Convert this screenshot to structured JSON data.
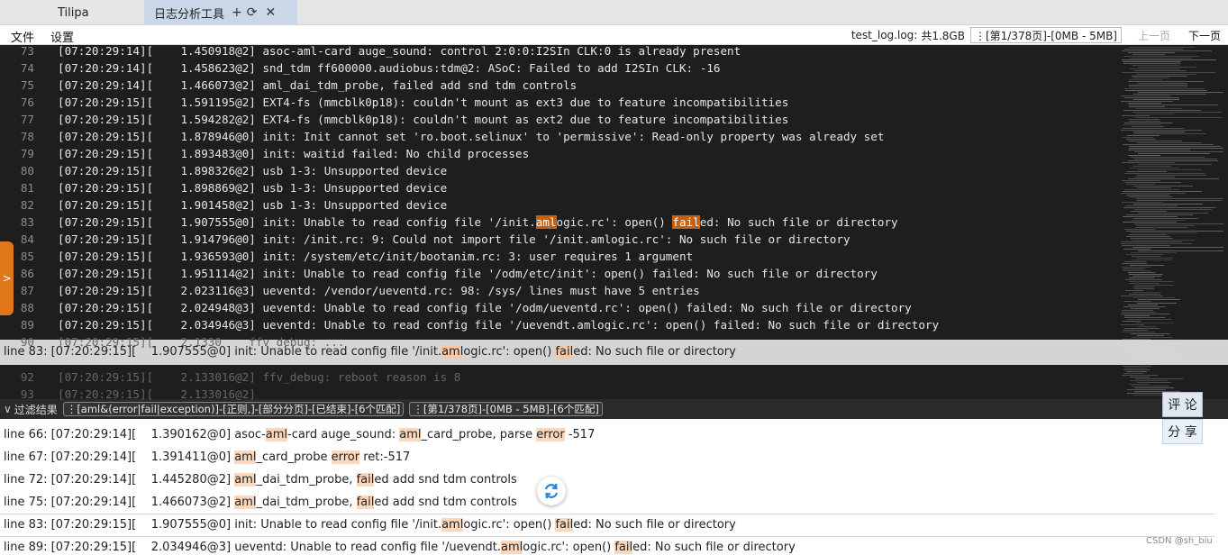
{
  "tabs": [
    {
      "label": "Tilipa"
    },
    {
      "label": "日志分析工具",
      "controls": [
        "+",
        "⟳",
        "✕"
      ]
    }
  ],
  "menu": [
    "文件",
    "设置"
  ],
  "file_info": {
    "name": "test_log.log:",
    "size": "共1.8GB",
    "page": "⋮[第1/378页]-[0MB - 5MB]",
    "prev_page": "上一页",
    "next_page": "下一页"
  },
  "side_handle": ">",
  "log_lines": [
    {
      "n": "73",
      "pre": "[07:20:29:14][    1.450918@2] asoc-aml-card auge_sound: control 2:0:0:I2SIn CLK:0 is already present",
      "h": []
    },
    {
      "n": "74",
      "pre": "[07:20:29:14][    1.458623@2] snd_tdm ff600000.audiobus:tdm@2: ASoC: Failed to add I2SIn CLK: -16",
      "h": []
    },
    {
      "n": "75",
      "pre": "[07:20:29:14][    1.466073@2] aml_dai_tdm_probe, failed add snd tdm controls",
      "h": []
    },
    {
      "n": "76",
      "pre": "[07:20:29:15][    1.591195@2] EXT4-fs (mmcblk0p18): couldn't mount as ext3 due to feature incompatibilities",
      "h": []
    },
    {
      "n": "77",
      "pre": "[07:20:29:15][    1.594282@2] EXT4-fs (mmcblk0p18): couldn't mount as ext2 due to feature incompatibilities",
      "h": []
    },
    {
      "n": "78",
      "pre": "[07:20:29:15][    1.878946@0] init: Init cannot set 'ro.boot.selinux' to 'permissive': Read-only property was already set",
      "h": []
    },
    {
      "n": "79",
      "pre": "[07:20:29:15][    1.893483@0] init: waitid failed: No child processes",
      "h": []
    },
    {
      "n": "80",
      "pre": "[07:20:29:15][    1.898326@2] usb 1-3: Unsupported device",
      "h": []
    },
    {
      "n": "81",
      "pre": "[07:20:29:15][    1.898869@2] usb 1-3: Unsupported device",
      "h": []
    },
    {
      "n": "82",
      "pre": "[07:20:29:15][    1.901458@2] usb 1-3: Unsupported device",
      "h": []
    },
    {
      "n": "83",
      "pre": "[07:20:29:15][    1.907555@0] init: Unable to read config file '/init.",
      "h": [
        [
          "aml",
          "ogic.rc': open() "
        ],
        [
          "fail",
          "ed: No such file or directory"
        ]
      ]
    },
    {
      "n": "84",
      "pre": "[07:20:29:15][    1.914796@0] init: /init.rc: 9: Could not import file '/init.amlogic.rc': No such file or directory",
      "h": []
    },
    {
      "n": "85",
      "pre": "[07:20:29:15][    1.936593@0] init: /system/etc/init/bootanim.rc: 3: user requires 1 argument",
      "h": []
    },
    {
      "n": "86",
      "pre": "[07:20:29:15][    1.951114@2] init: Unable to read config file '/odm/etc/init': open() failed: No such file or directory",
      "h": []
    },
    {
      "n": "87",
      "pre": "[07:20:29:15][    2.023116@3] ueventd: /vendor/ueventd.rc: 98: /sys/ lines must have 5 entries",
      "h": []
    },
    {
      "n": "88",
      "pre": "[07:20:29:15][    2.024948@3] ueventd: Unable to read config file '/odm/ueventd.rc': open() failed: No such file or directory",
      "h": []
    },
    {
      "n": "89",
      "pre": "[07:20:29:15][    2.034946@3] ueventd: Unable to read config file '/uevendt.amlogic.rc': open() failed: No such file or directory",
      "h": []
    }
  ],
  "ghost_lines": [
    {
      "n": "90",
      "text": "[07:20:29:15][    2.1330    ffv_debug: ..."
    },
    {
      "n": "92",
      "text": "[07:20:29:15][    2.133016@2] ffv_debug: reboot reason is 8"
    },
    {
      "n": "93",
      "text": "[07:20:29:15][    2.133016@2]"
    }
  ],
  "tooltip": {
    "prefix": "line 83: [07:20:29:15][    1.907555@0] init: Unable to read config file '/init.",
    "m1": "aml",
    "mid": "ogic.rc': open() ",
    "m2": "fail",
    "suffix": "ed: No such file or directory"
  },
  "filter": {
    "title": "过滤结果",
    "query_chip": "⋮[aml&(error|fail|exception)]-[正则,]-[部分分页]-[已结束]-[6个匹配]",
    "page_chip": "⋮[第1/378页]-[0MB - 5MB]-[6个匹配]"
  },
  "buttons": {
    "comment": "评 论",
    "share": "分 享"
  },
  "results": [
    {
      "parts": [
        "line 66: [07:20:29:14][    1.390162@0] asoc-",
        "aml",
        "-card auge_sound: ",
        "aml",
        "_card_probe, parse ",
        "error",
        " -517"
      ]
    },
    {
      "parts": [
        "line 67: [07:20:29:14][    1.391411@0] ",
        "aml",
        "_card_probe ",
        "error",
        " ret:-517"
      ]
    },
    {
      "parts": [
        "line 72: [07:20:29:14][    1.445280@2] ",
        "aml",
        "_dai_tdm_probe, ",
        "fail",
        "ed add snd tdm controls"
      ]
    },
    {
      "parts": [
        "line 75: [07:20:29:14][    1.466073@2] ",
        "aml",
        "_dai_tdm_probe, ",
        "fail",
        "ed add snd tdm controls"
      ]
    },
    {
      "parts": [
        "line 83: [07:20:29:15][    1.907555@0] init: Unable to read config file '/init.",
        "aml",
        "ogic.rc': open() ",
        "fail",
        "ed: No such file or directory"
      ]
    },
    {
      "parts": [
        "line 89: [07:20:29:15][    2.034946@3] ueventd: Unable to read config file '/uevendt.",
        "aml",
        "ogic.rc': open() ",
        "fail",
        "ed: No such file or directory"
      ]
    }
  ],
  "watermark": "CSDN @sh_biu",
  "colors": {
    "log_bg": "#1e1e1e",
    "highlight": "#c4600e",
    "match_bg": "#fbd7bd",
    "handle": "#e0781a"
  }
}
